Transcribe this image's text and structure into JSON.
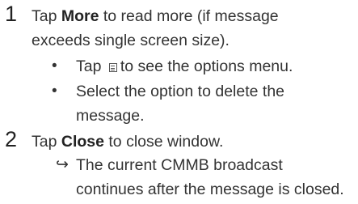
{
  "top_fragment": "",
  "step1": {
    "number": "1",
    "line1_pre": "Tap ",
    "line1_bold": "More",
    "line1_post": " to read more (if message",
    "line2": "exceeds single screen size).",
    "bullet_char": "•",
    "bullet1_pre": "Tap ",
    "bullet1_icon": "menu-icon",
    "bullet1_post": "to see the options menu.",
    "bullet2_line1": "Select the option to delete the",
    "bullet2_line2": "message."
  },
  "step2": {
    "number": "2",
    "line1_pre": "Tap ",
    "line1_bold": "Close",
    "line1_post": " to close window.",
    "arrow_char": "↪",
    "result_line1": "The current CMMB broadcast",
    "result_line2": "continues after the message is closed."
  }
}
